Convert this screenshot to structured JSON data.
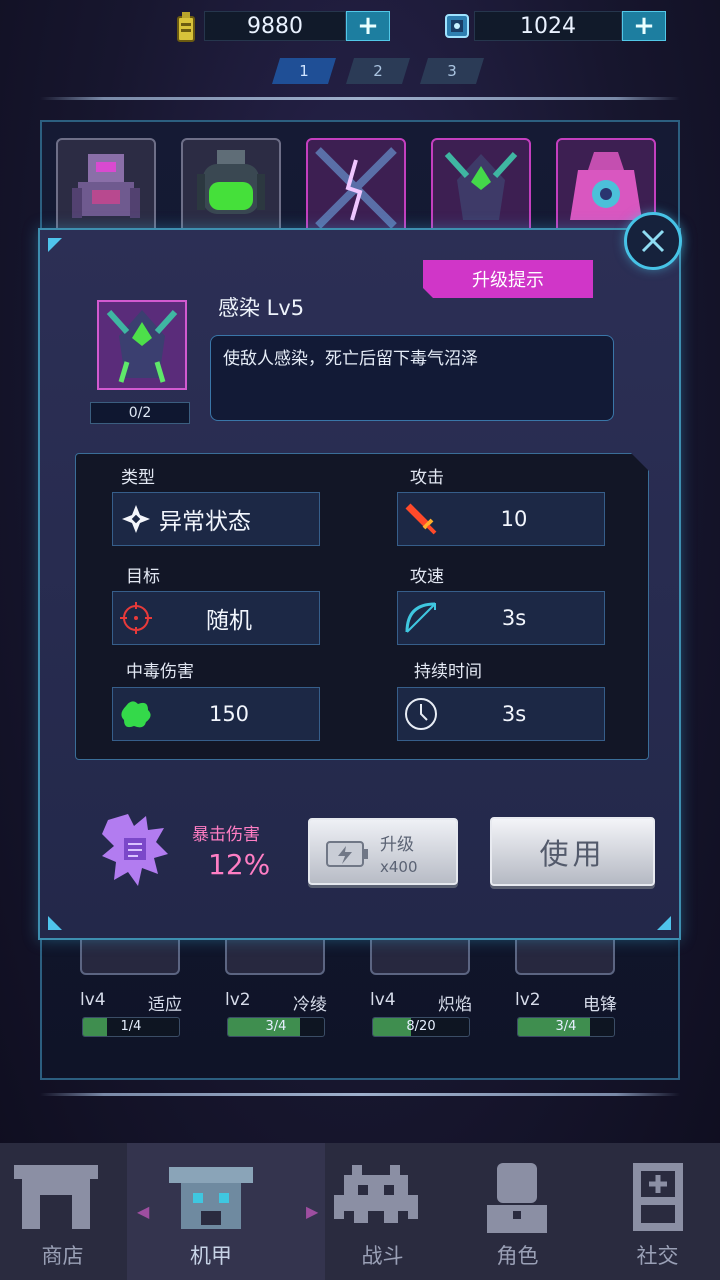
{
  "resources": [
    {
      "icon": "battery-icon",
      "value": "9880",
      "plus": "+"
    },
    {
      "icon": "chip-icon",
      "value": "1024",
      "plus": "+"
    }
  ],
  "pages": [
    "1",
    "2",
    "3"
  ],
  "inventory_bottom": [
    {
      "level": "lv4",
      "name": "适应",
      "progress": "1/4",
      "fill": 0.25
    },
    {
      "level": "lv2",
      "name": "冷绫",
      "progress": "3/4",
      "fill": 0.75
    },
    {
      "level": "lv4",
      "name": "炽焰",
      "progress": "8/20",
      "fill": 0.4
    },
    {
      "level": "lv2",
      "name": "电锋",
      "progress": "3/4",
      "fill": 0.75
    }
  ],
  "modal": {
    "upgrade_hint": "升级提示",
    "title": "感染 Lv5",
    "count": "0/2",
    "description": "使敌人感染，死亡后留下毒气沼泽",
    "stats": {
      "type_label": "类型",
      "type_value": "异常状态",
      "attack_label": "攻击",
      "attack_value": "10",
      "target_label": "目标",
      "target_value": "随机",
      "speed_label": "攻速",
      "speed_value": "3s",
      "poison_label": "中毒伤害",
      "poison_value": "150",
      "duration_label": "持续时间",
      "duration_value": "3s"
    },
    "crit_label": "暴击伤害",
    "crit_value": "12%",
    "upgrade_button": "升级",
    "upgrade_cost": "x400",
    "use_button": "使用"
  },
  "nav": [
    {
      "label": "商店",
      "icon": "shop-icon"
    },
    {
      "label": "机甲",
      "icon": "mech-icon",
      "active": true
    },
    {
      "label": "战斗",
      "icon": "invader-icon"
    },
    {
      "label": "角色",
      "icon": "character-icon"
    },
    {
      "label": "社交",
      "icon": "social-icon"
    }
  ],
  "colors": {
    "accent": "#47c3e6",
    "hint": "#d036c8",
    "crit": "#ff7ec4"
  }
}
